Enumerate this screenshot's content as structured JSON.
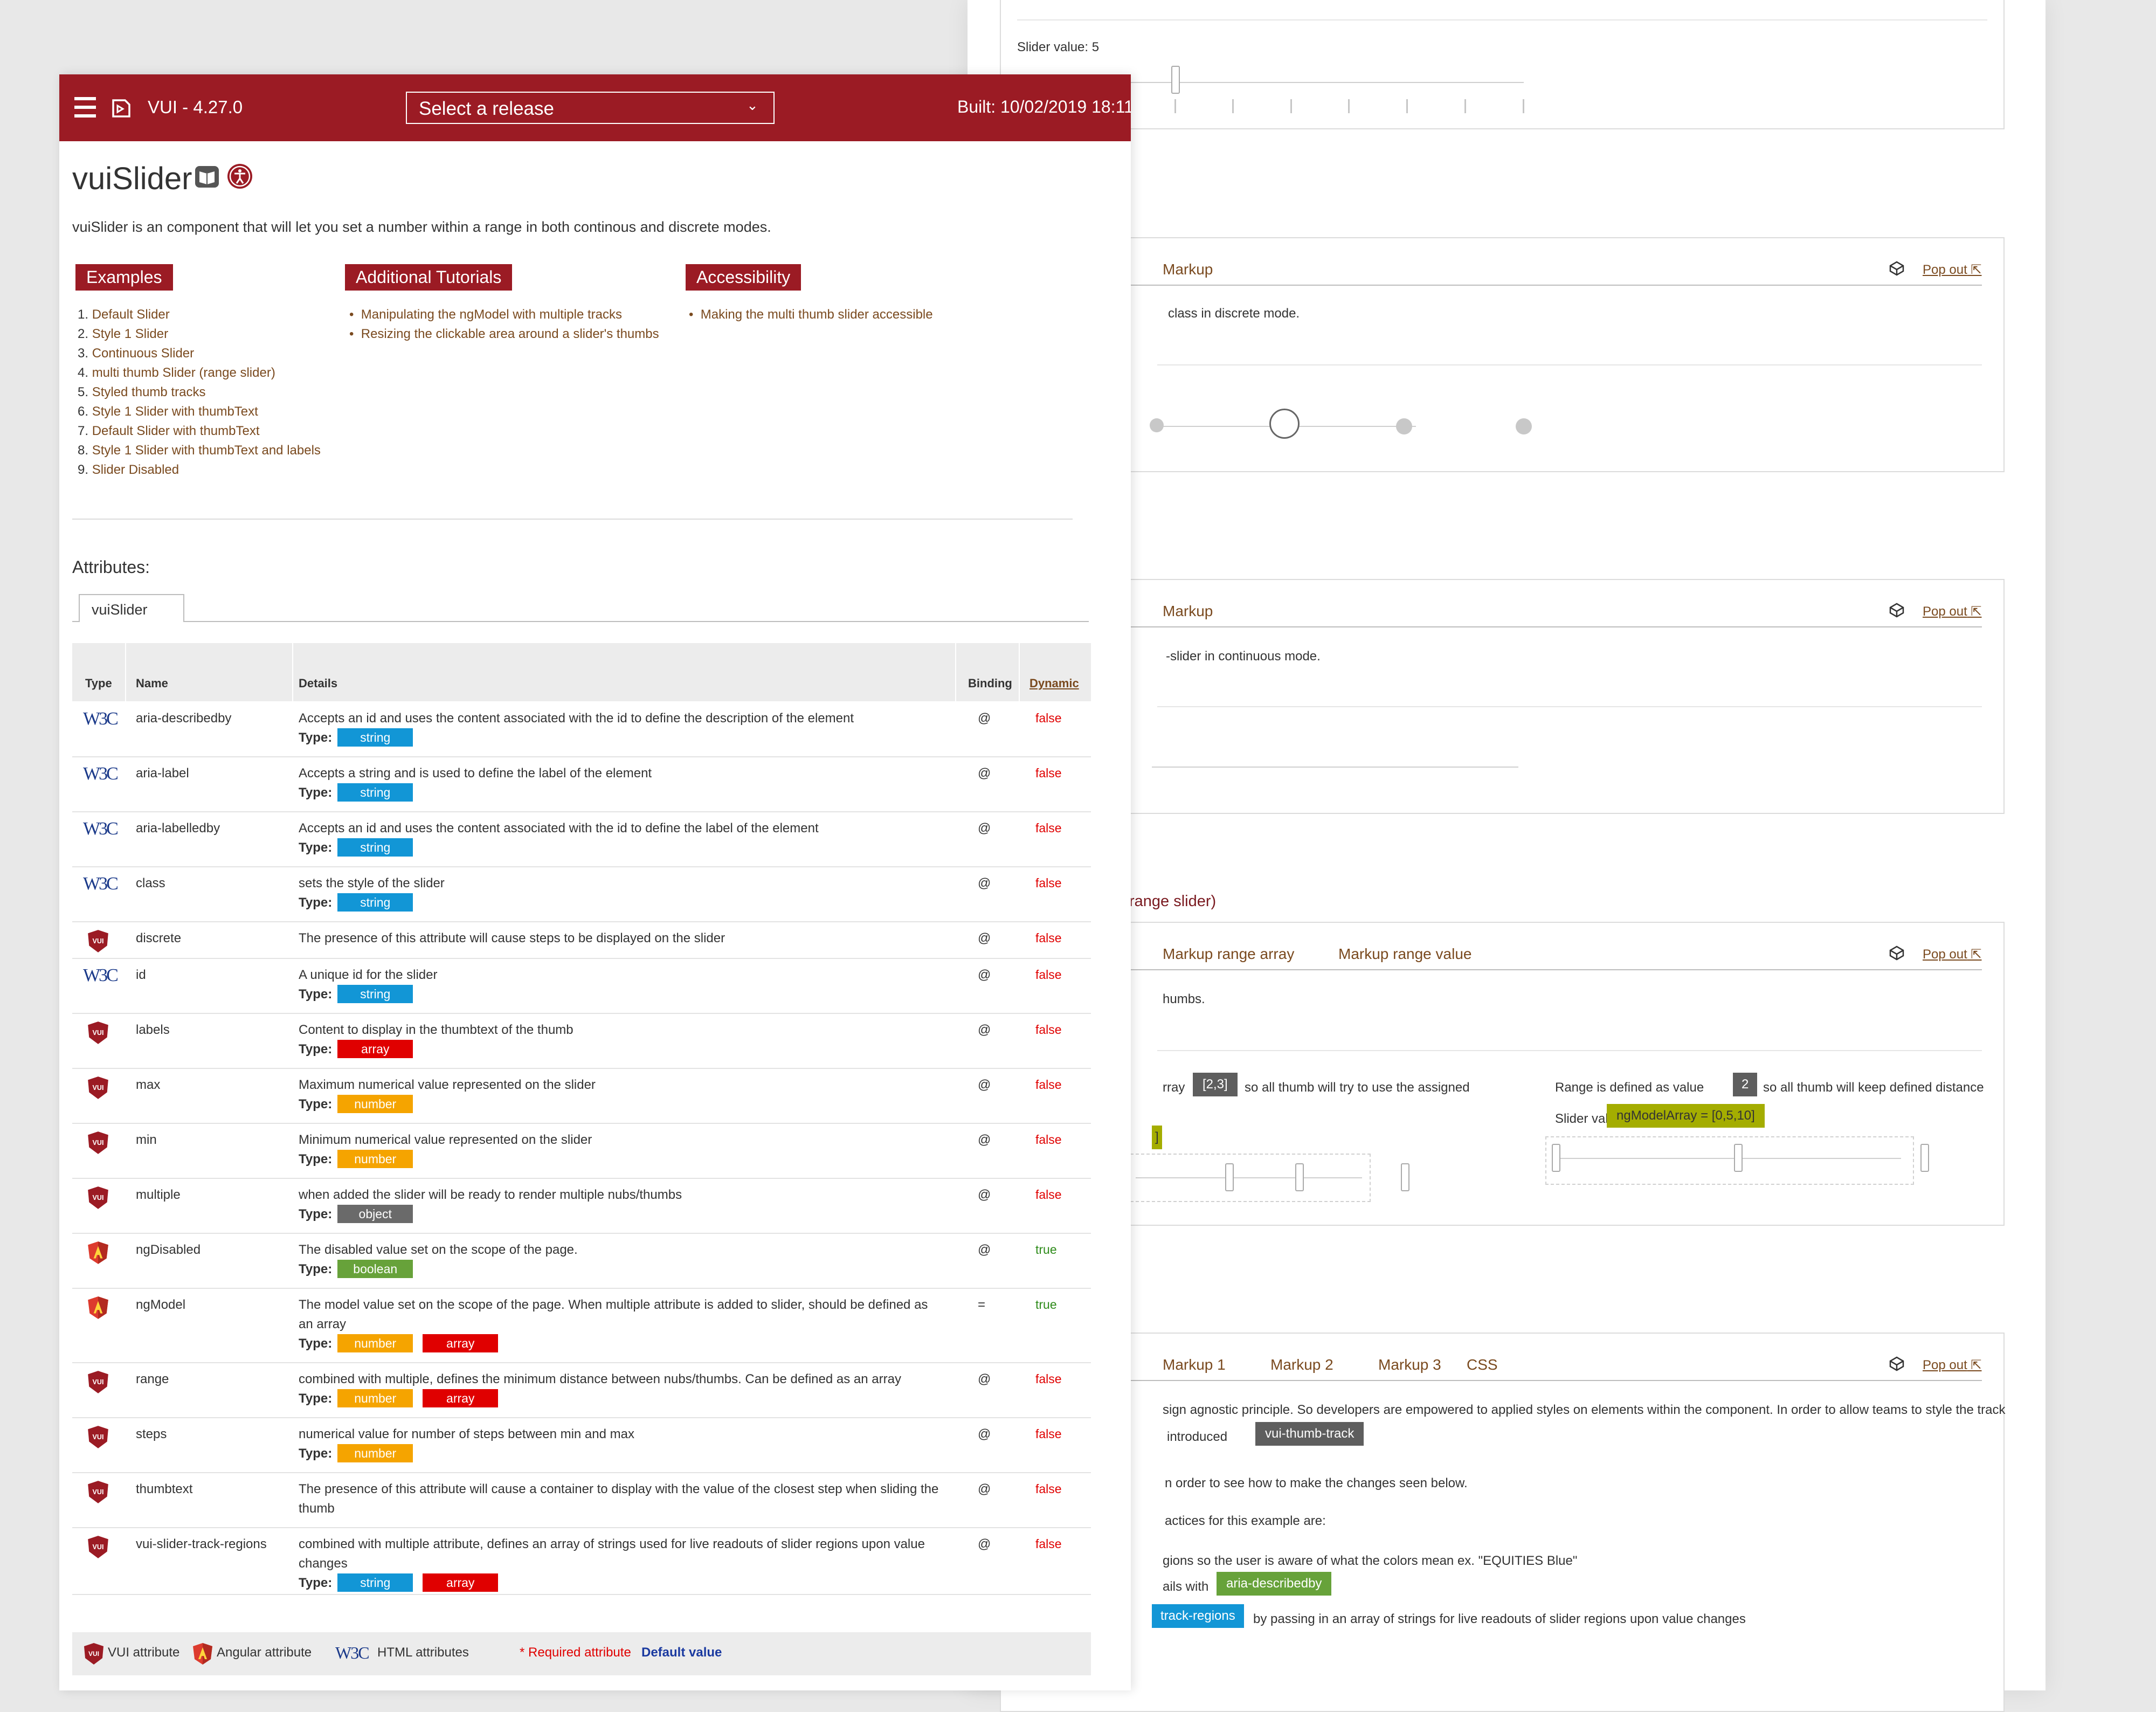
{
  "background": {
    "slider_value_label": "Slider value: 5",
    "panel1": {
      "tab": "Markup",
      "popout": "Pop out",
      "desc": "class in discrete mode."
    },
    "panel2": {
      "tab": "Markup",
      "popout": "Pop out",
      "desc": "-slider in continuous mode."
    },
    "range_heading": "range slider)",
    "panel3": {
      "tabs": [
        "Markup range array",
        "Markup range value"
      ],
      "popout": "Pop out",
      "desc": "humbs.",
      "left_text_a": "rray",
      "left_badge": "[2,3]",
      "left_text_b": "so all thumb will try to use the assigned",
      "right_text_a": "Range is defined as value",
      "right_badge": "2",
      "right_text_b": "so all thumb will keep defined distance",
      "slider_value_label": "Slider value:",
      "slider_value_badge": "ngModelArray = [0,5,10]",
      "left_value_badge": "]"
    },
    "panel4": {
      "tabs": [
        "Markup 1",
        "Markup 2",
        "Markup 3",
        "CSS"
      ],
      "popout": "Pop out",
      "line1": "sign agnostic principle. So developers are empowered to applied styles on elements within the component. In order to allow teams to style the track",
      "line2_a": "introduced",
      "line2_badge": "vui-thumb-track",
      "line3": "n order to see how to make the changes seen below.",
      "line4": "actices for this example are:",
      "line5": "gions so the user is aware of what the colors mean ex. \"EQUITIES Blue\"",
      "line6_a": "ails with",
      "line6_badge": "aria-describedby",
      "line7_badge": "track-regions",
      "line7_b": "by passing in an array of strings for live readouts of slider regions upon value changes",
      "stray": ";"
    }
  },
  "header": {
    "app_title": "VUI - 4.27.0",
    "release_select": "Select a release",
    "built": "Built: 10/02/2019 18:11"
  },
  "page": {
    "title": "vuiSlider",
    "intro": "vuiSlider is an component that will let you set a number within a range in both continous and discrete modes.",
    "examples_title": "Examples",
    "examples": [
      "Default Slider",
      "Style 1 Slider",
      "Continuous Slider",
      "multi thumb Slider (range slider)",
      "Styled thumb tracks",
      "Style 1 Slider with thumbText",
      "Default Slider with thumbText",
      "Style 1 Slider with thumbText and labels",
      "Slider Disabled"
    ],
    "tutorials_title": "Additional Tutorials",
    "tutorials": [
      "Manipulating the ngModel with multiple tracks",
      "Resizing the clickable area around a slider's thumbs"
    ],
    "accessibility_title": "Accessibility",
    "accessibility": [
      "Making the multi thumb slider accessible"
    ],
    "attributes_label": "Attributes:",
    "attr_tab": "vuiSlider"
  },
  "table": {
    "headers": {
      "type": "Type",
      "name": "Name",
      "details": "Details",
      "binding": "Binding",
      "dynamic": "Dynamic"
    },
    "type_label": "Type:",
    "rows": [
      {
        "kind": "w3c",
        "name": "aria-describedby",
        "details": "Accepts an id and uses the content associated with the id to define the description of the element",
        "types": [
          "string"
        ],
        "binding": "@",
        "dynamic": "false"
      },
      {
        "kind": "w3c",
        "name": "aria-label",
        "details": "Accepts a string and is used to define the label of the element",
        "types": [
          "string"
        ],
        "binding": "@",
        "dynamic": "false"
      },
      {
        "kind": "w3c",
        "name": "aria-labelledby",
        "details": "Accepts an id and uses the content associated with the id to define the label of the element",
        "types": [
          "string"
        ],
        "binding": "@",
        "dynamic": "false"
      },
      {
        "kind": "w3c",
        "name": "class",
        "details": "sets the style of the slider",
        "types": [
          "string"
        ],
        "binding": "@",
        "dynamic": "false"
      },
      {
        "kind": "vui",
        "name": "discrete",
        "details": "The presence of this attribute will cause steps to be displayed on the slider",
        "types": [],
        "binding": "@",
        "dynamic": "false"
      },
      {
        "kind": "w3c",
        "name": "id",
        "details": "A unique id for the slider",
        "types": [
          "string"
        ],
        "binding": "@",
        "dynamic": "false"
      },
      {
        "kind": "vui",
        "name": "labels",
        "details": "Content to display in the thumbtext of the thumb",
        "types": [
          "array"
        ],
        "binding": "@",
        "dynamic": "false"
      },
      {
        "kind": "vui",
        "name": "max",
        "details": "Maximum numerical value represented on the slider",
        "types": [
          "number"
        ],
        "binding": "@",
        "dynamic": "false"
      },
      {
        "kind": "vui",
        "name": "min",
        "details": "Minimum numerical value represented on the slider",
        "types": [
          "number"
        ],
        "binding": "@",
        "dynamic": "false"
      },
      {
        "kind": "vui",
        "name": "multiple",
        "details": "when added the slider will be ready to render multiple nubs/thumbs",
        "types": [
          "object"
        ],
        "binding": "@",
        "dynamic": "false"
      },
      {
        "kind": "ng",
        "name": "ngDisabled",
        "details": "The disabled value set on the scope of the page.",
        "types": [
          "boolean"
        ],
        "binding": "@",
        "dynamic": "true"
      },
      {
        "kind": "ng",
        "name": "ngModel",
        "details": "The model value set on the scope of the page. When multiple attribute is added to slider, should be defined as an array",
        "types": [
          "number",
          "array"
        ],
        "binding": "=",
        "dynamic": "true"
      },
      {
        "kind": "vui",
        "name": "range",
        "details": "combined with multiple, defines the minimum distance between nubs/thumbs. Can be defined as an array",
        "types": [
          "number",
          "array"
        ],
        "binding": "@",
        "dynamic": "false"
      },
      {
        "kind": "vui",
        "name": "steps",
        "details": "numerical value for number of steps between min and max",
        "types": [
          "number"
        ],
        "binding": "@",
        "dynamic": "false"
      },
      {
        "kind": "vui",
        "name": "thumbtext",
        "details": "The presence of this attribute will cause a container to display with the value of the closest step when sliding the thumb",
        "types": [],
        "binding": "@",
        "dynamic": "false"
      },
      {
        "kind": "vui",
        "name": "vui-slider-track-regions",
        "details": "combined with multiple attribute, defines an array of strings used for live readouts of slider regions upon value changes",
        "types": [
          "string",
          "array"
        ],
        "binding": "@",
        "dynamic": "false"
      }
    ]
  },
  "legend": {
    "vui": "VUI attribute",
    "ng": "Angular attribute",
    "w3c": "HTML attributes",
    "required": "* Required attribute",
    "default": "Default value"
  },
  "colors": {
    "brand": "#9b1b24",
    "link": "#7a4a1f",
    "string": "#1296d6",
    "array": "#e00000",
    "number": "#f5a400",
    "object": "#6a6a6a",
    "boolean": "#67a23a"
  }
}
